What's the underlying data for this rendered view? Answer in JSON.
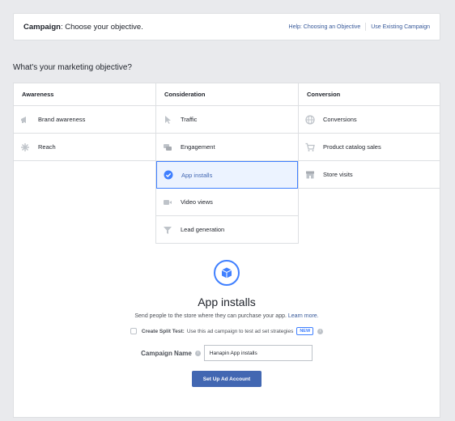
{
  "header": {
    "title_bold": "Campaign",
    "title_rest": ": Choose your objective.",
    "links": [
      "Help: Choosing an Objective",
      "Use Existing Campaign"
    ]
  },
  "question": "What's your marketing objective?",
  "columns": [
    {
      "heading": "Awareness",
      "items": [
        {
          "label": "Brand awareness",
          "icon": "megaphone-icon"
        },
        {
          "label": "Reach",
          "icon": "snowflake-icon"
        }
      ]
    },
    {
      "heading": "Consideration",
      "items": [
        {
          "label": "Traffic",
          "icon": "cursor-icon"
        },
        {
          "label": "Engagement",
          "icon": "chat-bubbles-icon"
        },
        {
          "label": "App installs",
          "icon": "check-circle-icon",
          "selected": true
        },
        {
          "label": "Video views",
          "icon": "video-camera-icon"
        },
        {
          "label": "Lead generation",
          "icon": "funnel-icon"
        }
      ]
    },
    {
      "heading": "Conversion",
      "items": [
        {
          "label": "Conversions",
          "icon": "globe-icon"
        },
        {
          "label": "Product catalog sales",
          "icon": "cart-icon"
        },
        {
          "label": "Store visits",
          "icon": "store-icon"
        }
      ]
    }
  ],
  "detail": {
    "icon": "box-icon",
    "title": "App installs",
    "description": "Send people to the store where they can purchase your app.",
    "learn_more": "Learn more.",
    "split_test_bold": "Create Split Test:",
    "split_test_text": "Use this ad campaign to test ad set strategies",
    "new_badge": "NEW",
    "campaign_name_label": "Campaign Name",
    "campaign_name_value": "Hanapin App installs",
    "setup_button": "Set Up Ad Account"
  },
  "colors": {
    "accent": "#4080ff",
    "button": "#4267b2",
    "link": "#365899"
  }
}
